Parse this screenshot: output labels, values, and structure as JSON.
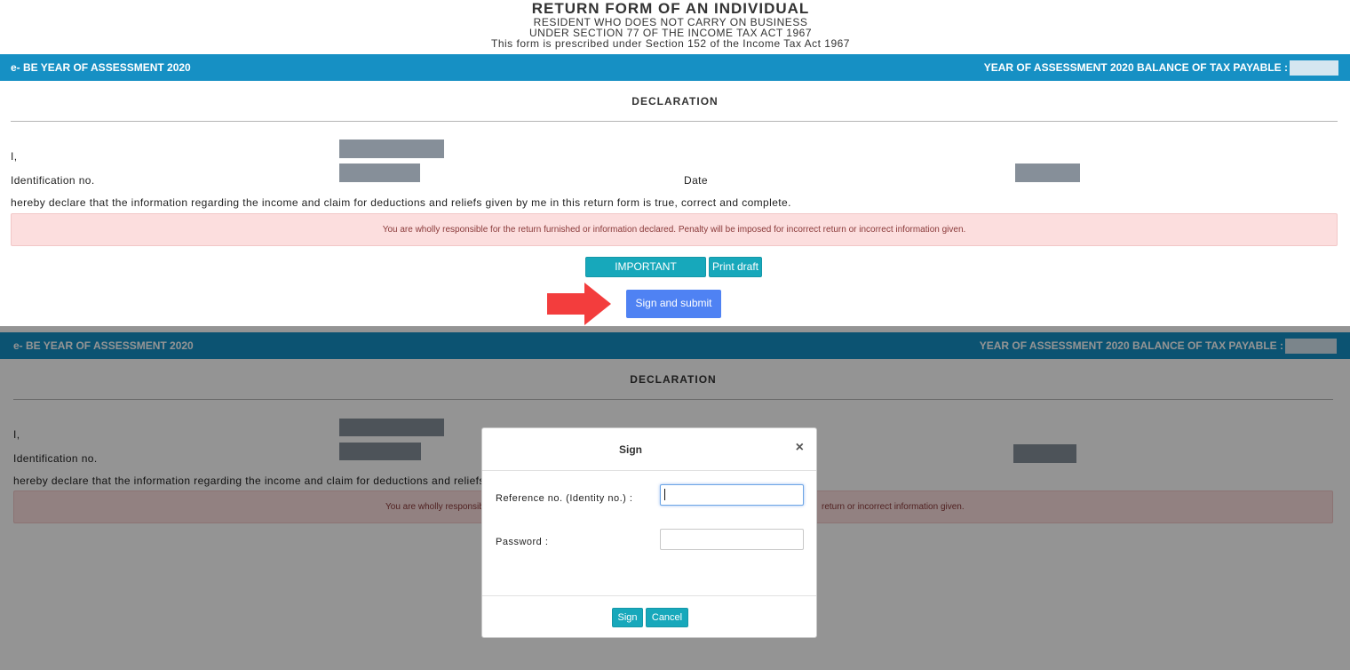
{
  "form": {
    "title": "RETURN FORM OF AN INDIVIDUAL",
    "sub1": "RESIDENT WHO DOES NOT CARRY ON BUSINESS",
    "sub2": "UNDER SECTION 77 OF THE INCOME TAX ACT 1967",
    "sub3": "This form is prescribed under Section 152 of the Income Tax Act 1967"
  },
  "bar": {
    "left_label": "e- BE YEAR OF ASSESSMENT 2020",
    "right_label": "YEAR OF ASSESSMENT 2020 BALANCE OF TAX PAYABLE :"
  },
  "declaration": {
    "heading": "DECLARATION",
    "i_label": "I,",
    "id_label": "Identification no.",
    "date_label": "Date",
    "statement": "hereby declare that the information regarding the income and claim for deductions and reliefs given by me in this return form is true, correct and complete.",
    "statement_truncated": "hereby declare that the information regarding the income and claim for deductions and reliefs giv",
    "alert": "You are wholly responsible for the return furnished or information declared. Penalty will be imposed for incorrect return or incorrect information given.",
    "alert_left": "You are wholly responsib",
    "alert_right": "return or incorrect information given."
  },
  "buttons": {
    "reminder": "IMPORTANT REMINDER",
    "print": "Print draft",
    "submit": "Sign and submit"
  },
  "modal": {
    "title": "Sign",
    "close": "×",
    "ref_label": "Reference no. (Identity no.) :",
    "ref_value": "",
    "password_label": "Password :",
    "password_value": "",
    "sign_button": "Sign",
    "cancel_button": "Cancel"
  },
  "colors": {
    "bar": "#1690c4",
    "teal_button": "#17a8bb",
    "blue_button": "#4f82f3",
    "alert_bg": "#fcdede",
    "arrow": "#f33d3d"
  }
}
